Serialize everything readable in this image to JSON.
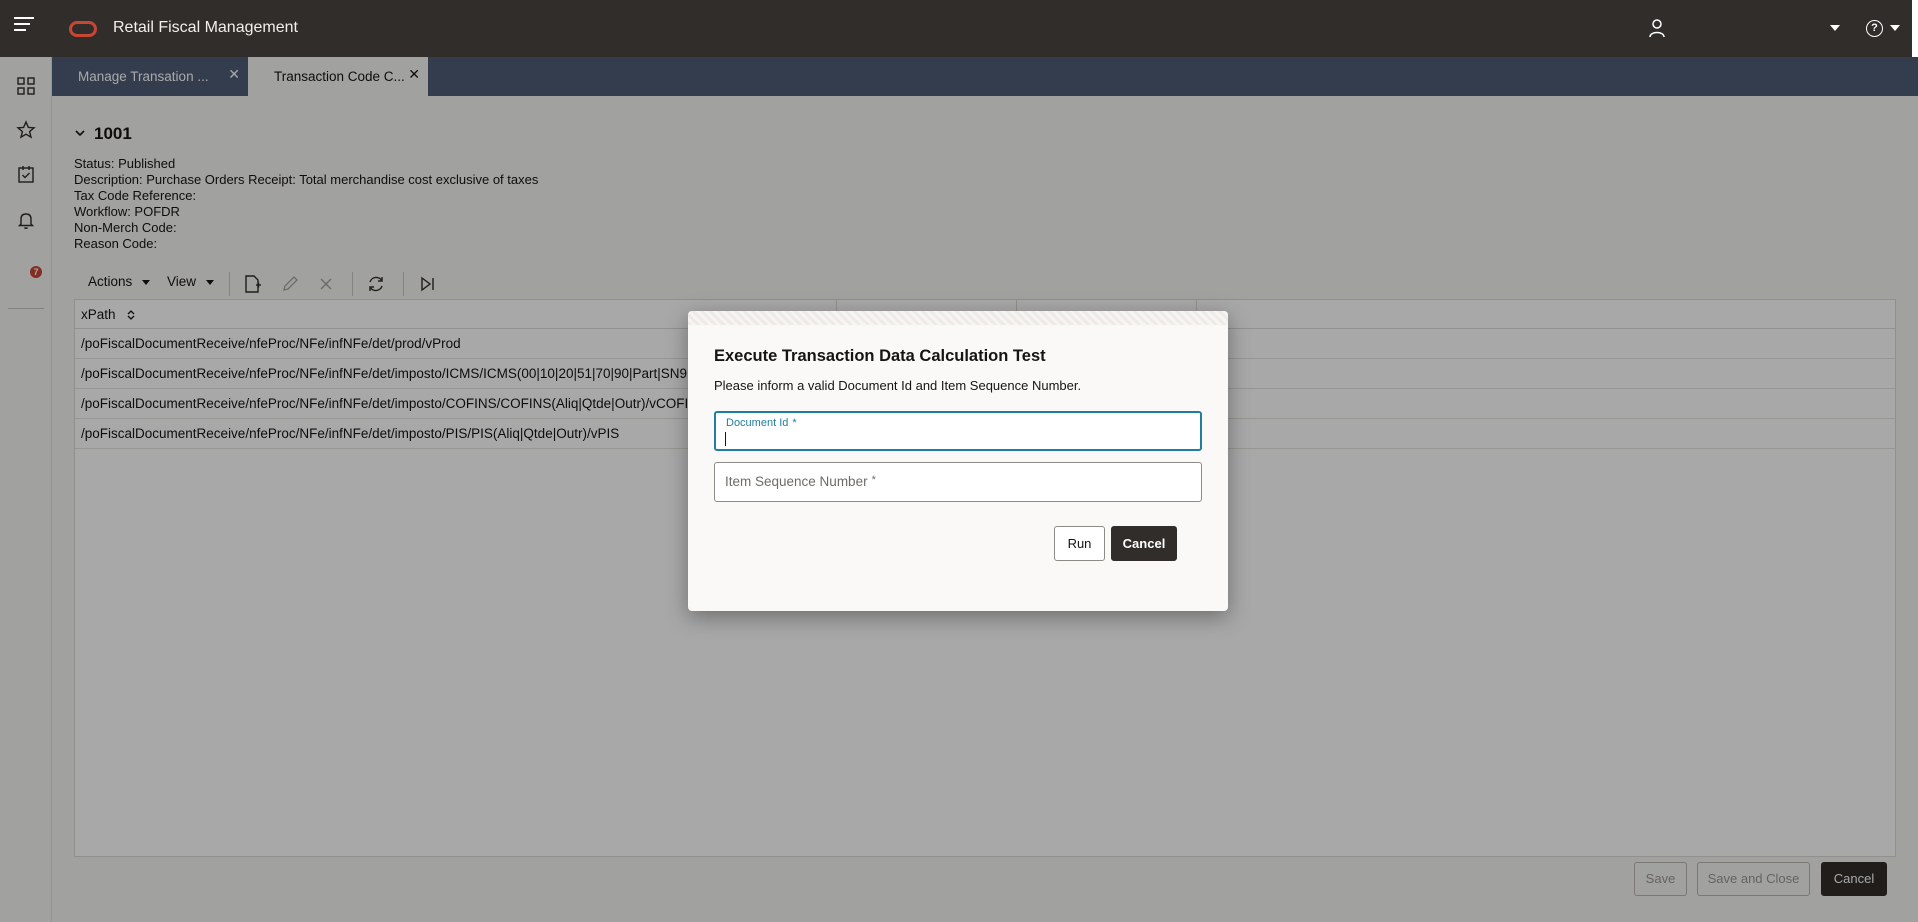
{
  "header": {
    "app_title": "Retail Fiscal Management",
    "user_name": "",
    "icons": [
      "hamburger-menu-icon",
      "oracle-logo",
      "user-icon",
      "help-icon"
    ]
  },
  "sidebar": {
    "items": [
      {
        "icon": "grid-icon"
      },
      {
        "icon": "star-icon"
      },
      {
        "icon": "task-checklist-icon"
      },
      {
        "icon": "bell-icon",
        "badge": "7"
      }
    ]
  },
  "tabs": [
    {
      "label": "Manage Transation ...",
      "active": false
    },
    {
      "label": "Transaction Code C...",
      "active": true
    }
  ],
  "record": {
    "title": "1001",
    "status": "Status: Published",
    "description": "Description: Purchase Orders Receipt: Total merchandise cost exclusive of taxes",
    "tax_code_reference": "Tax Code Reference:",
    "workflow": "Workflow: POFDR",
    "non_merch_code": "Non-Merch Code:",
    "reason_code": "Reason Code:"
  },
  "toolbar": {
    "actions_label": "Actions",
    "view_label": "View"
  },
  "grid": {
    "columns": [
      "xPath"
    ],
    "rows": [
      "/poFiscalDocumentReceive/nfeProc/NFe/infNFe/det/prod/vProd",
      "/poFiscalDocumentReceive/nfeProc/NFe/infNFe/det/imposto/ICMS/ICMS(00|10|20|51|70|90|Part|SN9",
      "/poFiscalDocumentReceive/nfeProc/NFe/infNFe/det/imposto/COFINS/COFINS(Aliq|Qtde|Outr)/vCOFINS",
      "/poFiscalDocumentReceive/nfeProc/NFe/infNFe/det/imposto/PIS/PIS(Aliq|Qtde|Outr)/vPIS"
    ]
  },
  "footer": {
    "save_label": "Save",
    "save_close_label": "Save and Close",
    "cancel_label": "Cancel"
  },
  "dialog": {
    "title": "Execute Transaction Data Calculation Test",
    "message": "Please inform a valid Document Id and Item Sequence Number.",
    "document_id_label": "Document Id",
    "document_id_value": "",
    "item_seq_label": "Item Sequence Number",
    "required_marker": "*",
    "run_label": "Run",
    "cancel_label": "Cancel"
  },
  "colors": {
    "header_bg": "#312d2a",
    "tabbar_bg": "#4f5d75",
    "brand": "#c74634",
    "focus": "#227e9e"
  }
}
